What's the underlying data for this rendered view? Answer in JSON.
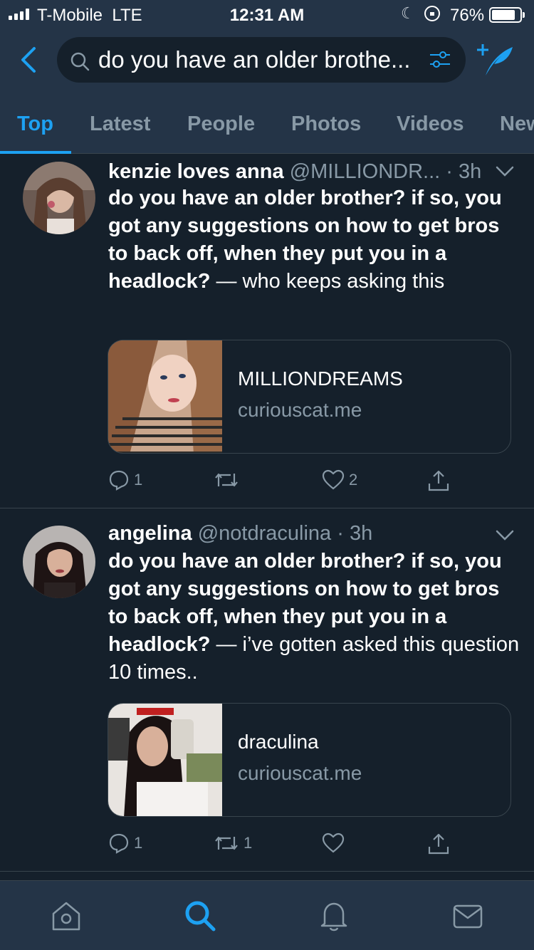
{
  "status_bar": {
    "carrier": "T-Mobile",
    "network": "LTE",
    "time": "12:31 AM",
    "battery": "76%",
    "battery_level": 0.76
  },
  "search": {
    "query": "do you have an older brothe..."
  },
  "tabs": [
    {
      "label": "Top",
      "active": true
    },
    {
      "label": "Latest",
      "active": false
    },
    {
      "label": "People",
      "active": false
    },
    {
      "label": "Photos",
      "active": false
    },
    {
      "label": "Videos",
      "active": false
    },
    {
      "label": "New",
      "active": false
    }
  ],
  "tweets": [
    {
      "name": "kenzie loves anna",
      "handle": "@MILLIONDR...",
      "time": "· 3h",
      "question": "do you have an older brother? if so, you got any suggestions on how to get bros to back off, when they put you in a headlock?",
      "answer": "— who keeps asking this",
      "card": {
        "title": "MILLIONDREAMS",
        "domain": "curiouscat.me"
      },
      "replies": "1",
      "retweets": "",
      "likes": "2"
    },
    {
      "name": "angelina",
      "handle": "@notdraculina",
      "time": "· 3h",
      "question": "do you have an older brother? if so, you got any suggestions on how to get bros to back off, when they put you in a headlock?",
      "answer": "— i’ve gotten asked this question 10 times..",
      "card": {
        "title": "draculina",
        "domain": "curiouscat.me"
      },
      "replies": "1",
      "retweets": "1",
      "likes": ""
    }
  ],
  "colors": {
    "accent": "#1da1f2",
    "background": "#15202b",
    "header": "#243447",
    "muted": "#8899a6"
  }
}
